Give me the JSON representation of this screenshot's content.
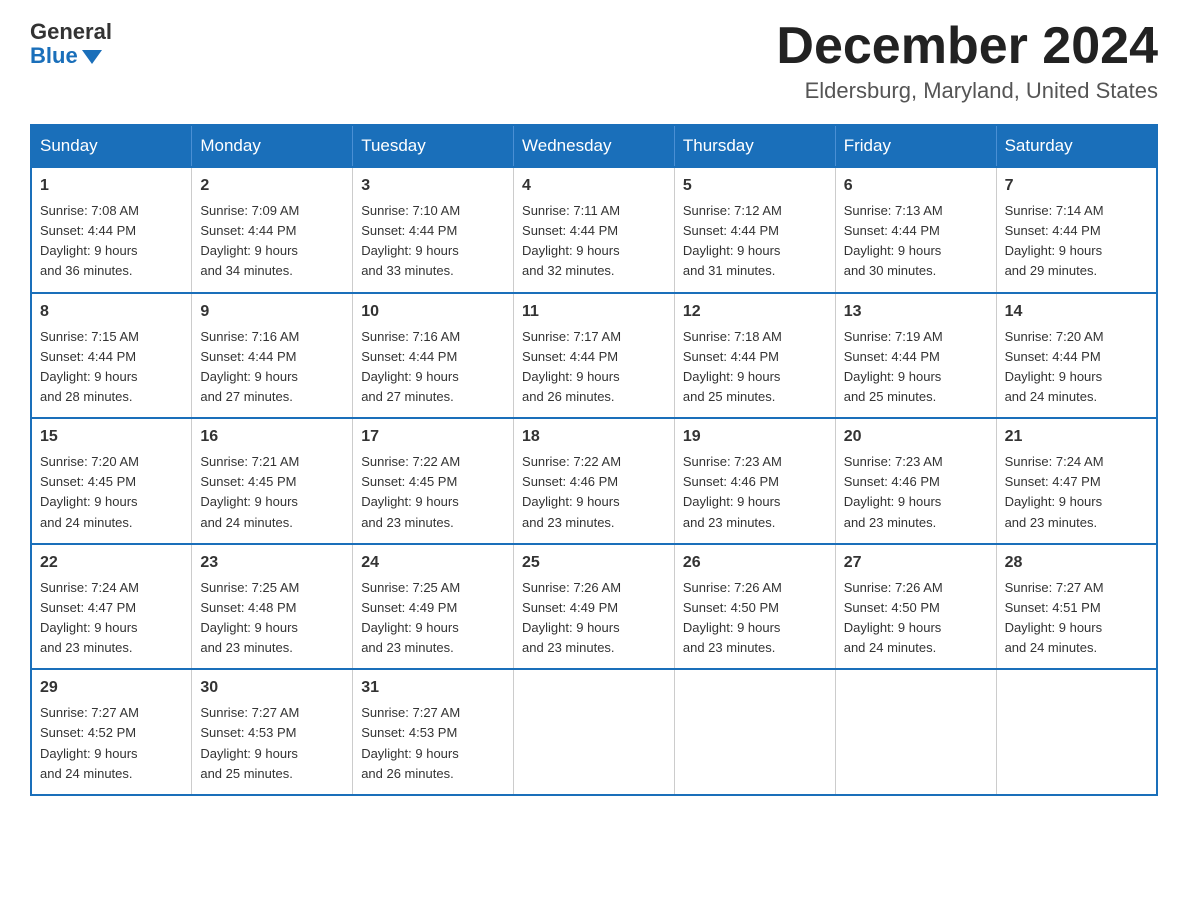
{
  "logo": {
    "general": "General",
    "blue": "Blue"
  },
  "title": "December 2024",
  "location": "Eldersburg, Maryland, United States",
  "weekdays": [
    "Sunday",
    "Monday",
    "Tuesday",
    "Wednesday",
    "Thursday",
    "Friday",
    "Saturday"
  ],
  "weeks": [
    [
      {
        "day": "1",
        "sunrise": "7:08 AM",
        "sunset": "4:44 PM",
        "daylight": "9 hours and 36 minutes."
      },
      {
        "day": "2",
        "sunrise": "7:09 AM",
        "sunset": "4:44 PM",
        "daylight": "9 hours and 34 minutes."
      },
      {
        "day": "3",
        "sunrise": "7:10 AM",
        "sunset": "4:44 PM",
        "daylight": "9 hours and 33 minutes."
      },
      {
        "day": "4",
        "sunrise": "7:11 AM",
        "sunset": "4:44 PM",
        "daylight": "9 hours and 32 minutes."
      },
      {
        "day": "5",
        "sunrise": "7:12 AM",
        "sunset": "4:44 PM",
        "daylight": "9 hours and 31 minutes."
      },
      {
        "day": "6",
        "sunrise": "7:13 AM",
        "sunset": "4:44 PM",
        "daylight": "9 hours and 30 minutes."
      },
      {
        "day": "7",
        "sunrise": "7:14 AM",
        "sunset": "4:44 PM",
        "daylight": "9 hours and 29 minutes."
      }
    ],
    [
      {
        "day": "8",
        "sunrise": "7:15 AM",
        "sunset": "4:44 PM",
        "daylight": "9 hours and 28 minutes."
      },
      {
        "day": "9",
        "sunrise": "7:16 AM",
        "sunset": "4:44 PM",
        "daylight": "9 hours and 27 minutes."
      },
      {
        "day": "10",
        "sunrise": "7:16 AM",
        "sunset": "4:44 PM",
        "daylight": "9 hours and 27 minutes."
      },
      {
        "day": "11",
        "sunrise": "7:17 AM",
        "sunset": "4:44 PM",
        "daylight": "9 hours and 26 minutes."
      },
      {
        "day": "12",
        "sunrise": "7:18 AM",
        "sunset": "4:44 PM",
        "daylight": "9 hours and 25 minutes."
      },
      {
        "day": "13",
        "sunrise": "7:19 AM",
        "sunset": "4:44 PM",
        "daylight": "9 hours and 25 minutes."
      },
      {
        "day": "14",
        "sunrise": "7:20 AM",
        "sunset": "4:44 PM",
        "daylight": "9 hours and 24 minutes."
      }
    ],
    [
      {
        "day": "15",
        "sunrise": "7:20 AM",
        "sunset": "4:45 PM",
        "daylight": "9 hours and 24 minutes."
      },
      {
        "day": "16",
        "sunrise": "7:21 AM",
        "sunset": "4:45 PM",
        "daylight": "9 hours and 24 minutes."
      },
      {
        "day": "17",
        "sunrise": "7:22 AM",
        "sunset": "4:45 PM",
        "daylight": "9 hours and 23 minutes."
      },
      {
        "day": "18",
        "sunrise": "7:22 AM",
        "sunset": "4:46 PM",
        "daylight": "9 hours and 23 minutes."
      },
      {
        "day": "19",
        "sunrise": "7:23 AM",
        "sunset": "4:46 PM",
        "daylight": "9 hours and 23 minutes."
      },
      {
        "day": "20",
        "sunrise": "7:23 AM",
        "sunset": "4:46 PM",
        "daylight": "9 hours and 23 minutes."
      },
      {
        "day": "21",
        "sunrise": "7:24 AM",
        "sunset": "4:47 PM",
        "daylight": "9 hours and 23 minutes."
      }
    ],
    [
      {
        "day": "22",
        "sunrise": "7:24 AM",
        "sunset": "4:47 PM",
        "daylight": "9 hours and 23 minutes."
      },
      {
        "day": "23",
        "sunrise": "7:25 AM",
        "sunset": "4:48 PM",
        "daylight": "9 hours and 23 minutes."
      },
      {
        "day": "24",
        "sunrise": "7:25 AM",
        "sunset": "4:49 PM",
        "daylight": "9 hours and 23 minutes."
      },
      {
        "day": "25",
        "sunrise": "7:26 AM",
        "sunset": "4:49 PM",
        "daylight": "9 hours and 23 minutes."
      },
      {
        "day": "26",
        "sunrise": "7:26 AM",
        "sunset": "4:50 PM",
        "daylight": "9 hours and 23 minutes."
      },
      {
        "day": "27",
        "sunrise": "7:26 AM",
        "sunset": "4:50 PM",
        "daylight": "9 hours and 24 minutes."
      },
      {
        "day": "28",
        "sunrise": "7:27 AM",
        "sunset": "4:51 PM",
        "daylight": "9 hours and 24 minutes."
      }
    ],
    [
      {
        "day": "29",
        "sunrise": "7:27 AM",
        "sunset": "4:52 PM",
        "daylight": "9 hours and 24 minutes."
      },
      {
        "day": "30",
        "sunrise": "7:27 AM",
        "sunset": "4:53 PM",
        "daylight": "9 hours and 25 minutes."
      },
      {
        "day": "31",
        "sunrise": "7:27 AM",
        "sunset": "4:53 PM",
        "daylight": "9 hours and 26 minutes."
      },
      null,
      null,
      null,
      null
    ]
  ],
  "labels": {
    "sunrise_prefix": "Sunrise: ",
    "sunset_prefix": "Sunset: ",
    "daylight_prefix": "Daylight: "
  }
}
